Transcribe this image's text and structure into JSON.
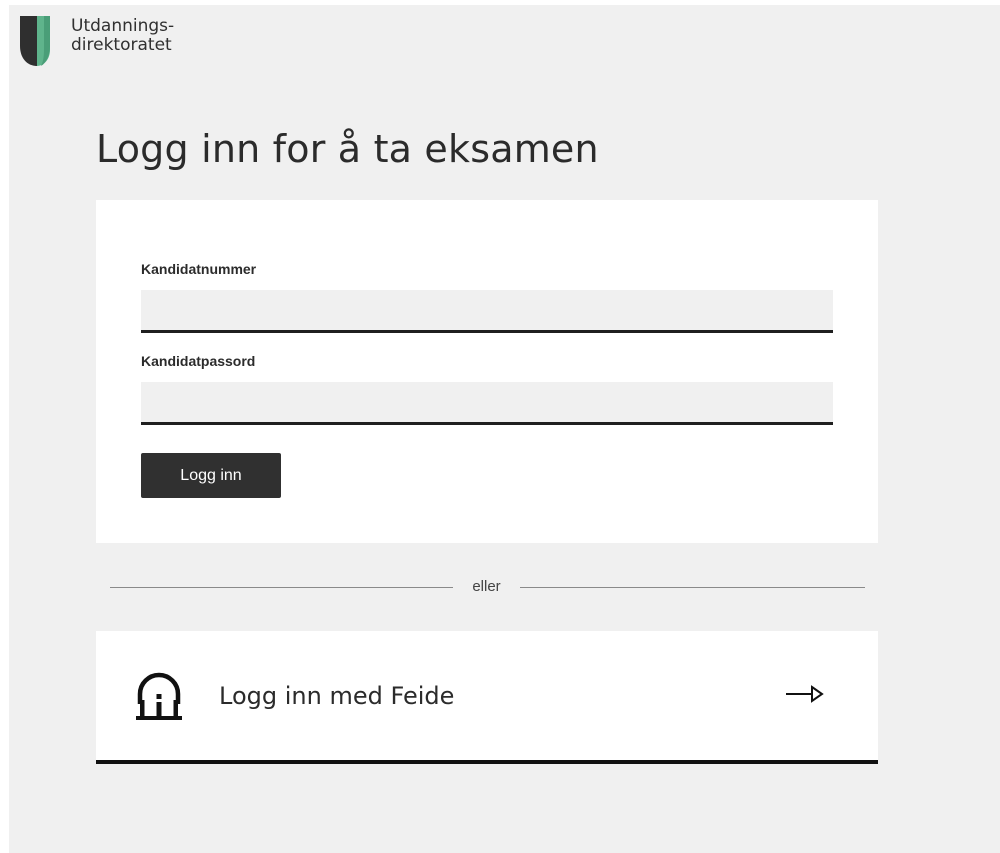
{
  "brand": {
    "name_line1": "Utdannings-",
    "name_line2": "direktoratet",
    "colors": {
      "dark": "#2f2f2f",
      "green": "#5fb48c"
    }
  },
  "page": {
    "title": "Logg inn for å ta eksamen"
  },
  "login_form": {
    "candidate_number_label": "Kandidatnummer",
    "candidate_number_value": "",
    "candidate_password_label": "Kandidatpassord",
    "candidate_password_value": "",
    "submit_label": "Logg inn"
  },
  "divider": {
    "text": "eller"
  },
  "feide": {
    "label": "Logg inn med Feide",
    "icon": "feide-icon",
    "arrow_icon": "arrow-right-icon"
  }
}
